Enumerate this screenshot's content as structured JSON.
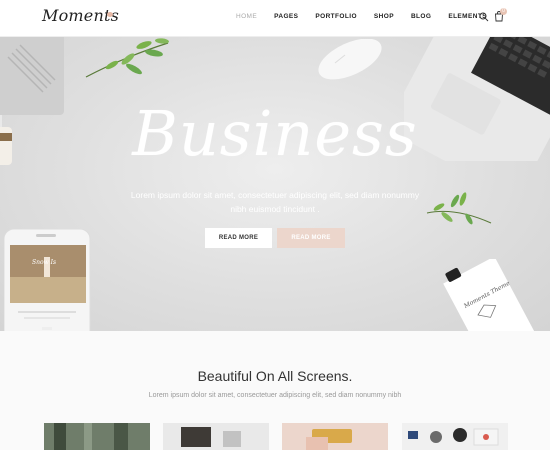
{
  "header": {
    "logo": "Moments",
    "nav": [
      "HOME",
      "PAGES",
      "PORTFOLIO",
      "SHOP",
      "BLOG",
      "ELEMENTS"
    ],
    "active_nav": "HOME",
    "cart_count": "0"
  },
  "hero": {
    "title": "Business",
    "text": "Lorem ipsum dolor sit amet, consectetuer adipiscing elit, sed diam nonummy nibh euismod tincidunt .",
    "button_primary": "READ MORE",
    "button_secondary": "READ MORE",
    "phone_title": "Snow Is",
    "tube_label": "Moments Theme"
  },
  "section": {
    "title": "Beautiful On All Screens.",
    "subtitle": "Lorem ipsum dolor sit amet, consectetuer adipiscing elit, sed diam nonummy nibh"
  },
  "colors": {
    "accent": "#ecd6cc",
    "hero_bg": "#dfdfdf",
    "leaf": "#6aa84f"
  },
  "icons": [
    "search-icon",
    "cart-icon",
    "leaf-icon"
  ]
}
